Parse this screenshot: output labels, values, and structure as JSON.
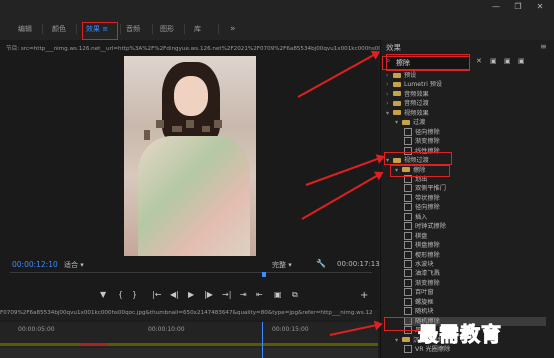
{
  "window": {
    "tabs": [
      "编辑",
      "颜色",
      "效果",
      "音频",
      "图形",
      "库"
    ],
    "active_tab_menu": "≡",
    "more": "»",
    "controls": [
      "—",
      "❐",
      "✕"
    ]
  },
  "monitor": {
    "title": "节目: src=http___nimg.ws.126.net__url=http%3A%2F%2Fdingyue.ws.126.net%2F2021%2F0709%2F6a85534bj00qvu1x001kc000hs00qoc.jpg&thumbnail",
    "timecode": "00:00:12:10",
    "fit": "适合",
    "quality": "完整",
    "duration": "00:00:17:13",
    "controls": [
      "▼",
      "{",
      "}",
      "|←",
      "◀|",
      "▶",
      "|▶",
      "→|",
      "⇥",
      "⇤",
      "▣",
      "⧉"
    ],
    "plus": "+"
  },
  "timeline": {
    "header": "F0709%2F6a85534bj00qvu1x001kc000hs00qoc.jpg&thumbnail=650x2147483647&quality=80&type=jpg&refer=http___nimg.ws.12",
    "ruler": [
      "00:00:05:00",
      "00:00:10:00",
      "00:00:15:00"
    ]
  },
  "effects": {
    "title": "效果",
    "menu": "≡",
    "search_value": "擦除",
    "clear": "✕",
    "tool_icons": [
      "▣",
      "▣",
      "▣"
    ],
    "tree": [
      {
        "label": "预设",
        "type": "folder",
        "level": 0,
        "open": false
      },
      {
        "label": "Lumetri 预设",
        "type": "folder",
        "level": 0,
        "open": false
      },
      {
        "label": "音频效果",
        "type": "folder",
        "level": 0,
        "open": false
      },
      {
        "label": "音频过渡",
        "type": "folder",
        "level": 0,
        "open": false
      },
      {
        "label": "视频效果",
        "type": "folder",
        "level": 0,
        "open": true
      },
      {
        "label": "过渡",
        "type": "folder",
        "level": 1,
        "open": true
      },
      {
        "label": "径向擦除",
        "type": "file",
        "level": 2
      },
      {
        "label": "渐变擦除",
        "type": "file",
        "level": 2
      },
      {
        "label": "线性擦除",
        "type": "file",
        "level": 2
      },
      {
        "label": "视频过渡",
        "type": "folder",
        "level": 0,
        "open": true
      },
      {
        "label": "擦除",
        "type": "folder",
        "level": 1,
        "open": true
      },
      {
        "label": "划出",
        "type": "file",
        "level": 2
      },
      {
        "label": "双侧平推门",
        "type": "file",
        "level": 2
      },
      {
        "label": "带状擦除",
        "type": "file",
        "level": 2
      },
      {
        "label": "径向擦除",
        "type": "file",
        "level": 2
      },
      {
        "label": "插入",
        "type": "file",
        "level": 2
      },
      {
        "label": "时钟式擦除",
        "type": "file",
        "level": 2
      },
      {
        "label": "棋盘",
        "type": "file",
        "level": 2
      },
      {
        "label": "棋盘擦除",
        "type": "file",
        "level": 2
      },
      {
        "label": "楔形擦除",
        "type": "file",
        "level": 2
      },
      {
        "label": "水波块",
        "type": "file",
        "level": 2
      },
      {
        "label": "油漆飞溅",
        "type": "file",
        "level": 2
      },
      {
        "label": "渐变擦除",
        "type": "file",
        "level": 2
      },
      {
        "label": "百叶窗",
        "type": "file",
        "level": 2
      },
      {
        "label": "螺旋框",
        "type": "file",
        "level": 2
      },
      {
        "label": "随机块",
        "type": "file",
        "level": 2
      },
      {
        "label": "随机擦除",
        "type": "file",
        "level": 2,
        "selected": true
      },
      {
        "label": "风车",
        "type": "file",
        "level": 2
      },
      {
        "label": "沉浸式视频",
        "type": "folder",
        "level": 1,
        "open": true
      },
      {
        "label": "VR 光圈擦除",
        "type": "file",
        "level": 2
      }
    ]
  },
  "watermark": "最需教育",
  "colors": {
    "accent": "#3b8cff",
    "annotation": "#e02020"
  }
}
